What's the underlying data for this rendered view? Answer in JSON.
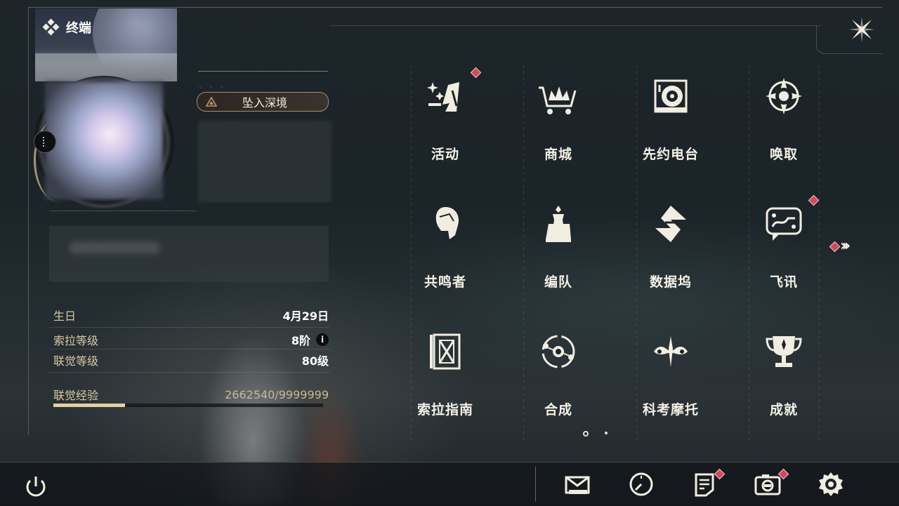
{
  "colors": {
    "accent_gold": "#d8c9a4",
    "badge_red": "#d14a58",
    "panel_bg": "#1b2429"
  },
  "header": {
    "title": "终端",
    "title_icon": "diamond-cluster-icon",
    "close_icon": "close-x-icon"
  },
  "profile": {
    "depth_button_label": "坠入深境",
    "info": [
      {
        "key": "生日",
        "value": "4月29日"
      },
      {
        "key": "索拉等级",
        "value": "8阶"
      },
      {
        "key": "联觉等级",
        "value": "80级"
      }
    ],
    "info_icon_glyph": "i",
    "exp": {
      "key": "联觉经验",
      "value": "2662540/9999999",
      "fraction": 0.266
    }
  },
  "menu": [
    {
      "label": "活动",
      "icon": "activity-sparkle-icon",
      "badge": true
    },
    {
      "label": "商城",
      "icon": "shop-cart-icon",
      "badge": false
    },
    {
      "label": "先约电台",
      "icon": "radio-record-icon",
      "badge": false
    },
    {
      "label": "唤取",
      "icon": "compass-star-icon",
      "badge": false
    },
    {
      "label": "共鸣者",
      "icon": "resonator-head-icon",
      "badge": false
    },
    {
      "label": "编队",
      "icon": "chess-team-icon",
      "badge": false
    },
    {
      "label": "数据坞",
      "icon": "data-dock-icon",
      "badge": false
    },
    {
      "label": "飞讯",
      "icon": "chat-message-icon",
      "badge": true
    },
    {
      "label": "索拉指南",
      "icon": "guide-book-icon",
      "badge": false
    },
    {
      "label": "合成",
      "icon": "synthesis-orbit-icon",
      "badge": false
    },
    {
      "label": "科考摩托",
      "icon": "motorcycle-icon",
      "badge": false
    },
    {
      "label": "成就",
      "icon": "trophy-icon",
      "badge": false
    }
  ],
  "pagination": {
    "current": 1,
    "total": 2
  },
  "bottom_bar": [
    {
      "icon": "mail-icon",
      "badge": false
    },
    {
      "icon": "clock-icon",
      "badge": false
    },
    {
      "icon": "notes-icon",
      "badge": true
    },
    {
      "icon": "camera-icon",
      "badge": true
    },
    {
      "icon": "settings-gear-icon",
      "badge": false
    }
  ]
}
